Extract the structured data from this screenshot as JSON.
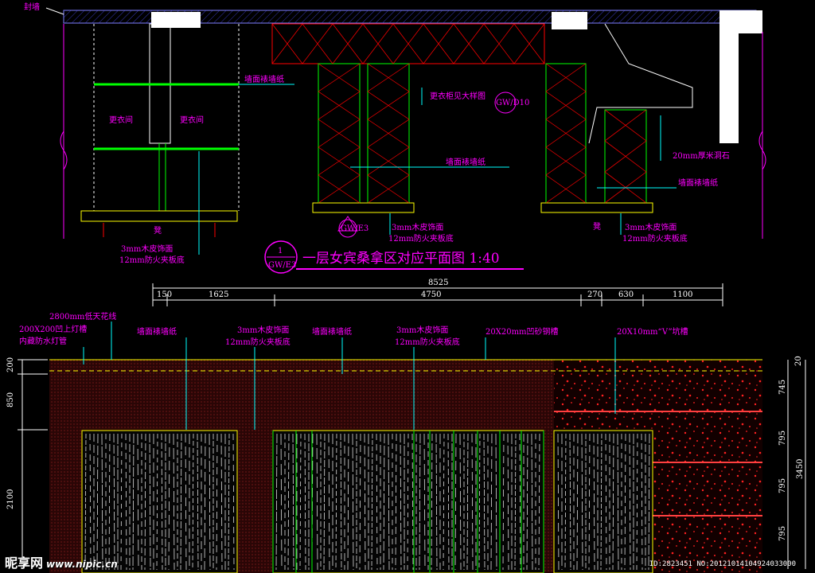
{
  "plan": {
    "top_left_label": "封墙",
    "room_left": "更衣间",
    "room_right": "更衣间",
    "wallpaper_1": "墙面裱墙纸",
    "wallpaper_2": "墙面裱墙纸",
    "wallpaper_3": "墙面裱墙纸",
    "locker_note": "更衣柜见大样图",
    "locker_ref": "GW/D10",
    "marble_note": "20mm厚米洞石",
    "veneer_1_line1": "3mm木皮饰面",
    "veneer_1_line2": "12mm防火夹板底",
    "veneer_2_line1": "3mm木皮饰面",
    "veneer_2_line2": "12mm防火夹板底",
    "veneer_3_line1": "3mm木皮饰面",
    "veneer_3_line2": "12mm防火夹板底",
    "bench_left": "凳",
    "bench_right": "凳",
    "elev_ref": "GW/E3",
    "title_num": "1",
    "title_sheet": "GW/E3",
    "title": "一层女宾桑拿区对应平面图 1:40"
  },
  "dims": {
    "overall": "8525",
    "segments": [
      "150",
      "1625",
      "4750",
      "270",
      "630",
      "1100"
    ],
    "left_vertical": [
      "200",
      "850",
      "2100"
    ],
    "right_vertical": [
      "20",
      "745",
      "795",
      "795",
      "795"
    ],
    "right_total": "3450"
  },
  "elevation": {
    "callout_ceiling": "2800mm低天花线",
    "callout_light_1": "200X200凹上灯槽",
    "callout_light_2": "内藏防水灯管",
    "callout_wallpaper_1": "墙面裱墙纸",
    "callout_veneer_1a": "3mm木皮饰面",
    "callout_veneer_1b": "12mm防火夹板底",
    "callout_wallpaper_2": "墙面裱墙纸",
    "callout_veneer_2a": "3mm木皮饰面",
    "callout_veneer_2b": "12mm防火夹板底",
    "callout_groove_sand": "20X20mm凹砂钢槽",
    "callout_groove_v": "20X10mm“V”坑槽"
  },
  "watermark": {
    "logo": "昵享网",
    "url": "www.nipic.cn",
    "id": "ID:2823451 NO:20121014104924033000"
  },
  "colors": {
    "bg": "#000000",
    "magenta": "#ff00ff",
    "green": "#00ff00",
    "yellow": "#ffff00",
    "red": "#ff0000",
    "white": "#ffffff",
    "cyan": "#00ffff",
    "blue": "#4b4bff"
  }
}
